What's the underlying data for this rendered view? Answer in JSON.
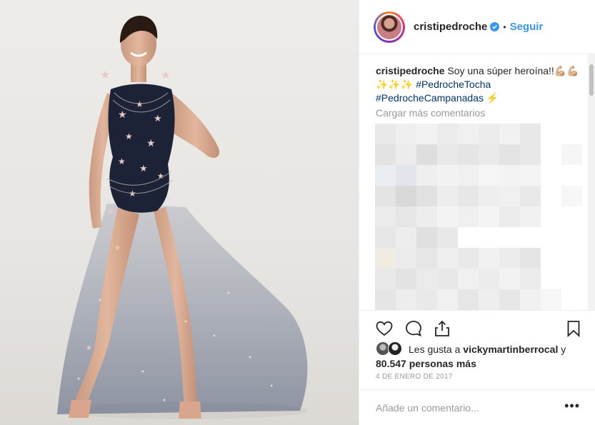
{
  "post": {
    "username": "cristipedroche",
    "follow_label": "Seguir",
    "separator": "•",
    "caption": {
      "username": "cristipedroche",
      "text": "Soy una súper heroína!!💪🏼💪🏼✨✨✨ ",
      "hashtag1": "#PedrocheTocha",
      "hashtag2": "#PedrocheCampanadas",
      "emoji_end": " ⚡️"
    },
    "load_more_label": "Cargar más comentarios",
    "truncated_comment": "░░░░░░░░░░░░░░░░░░░░░░░░░░░░░░",
    "likes": {
      "prefix": "Les gusta a ",
      "user": "vickymartinberrocal",
      "middle": " y ",
      "count": "80.547 personas más"
    },
    "date": "4 DE ENERO DE 2017",
    "add_comment_placeholder": "Añade un comentario...",
    "more_options": "•••"
  },
  "icons": {
    "verified": "verified-badge-icon",
    "like": "heart-icon",
    "comment": "comment-bubble-icon",
    "share": "share-icon",
    "save": "bookmark-icon"
  },
  "colors": {
    "link": "#3897f0",
    "hashtag": "#003569",
    "muted": "#999999"
  }
}
